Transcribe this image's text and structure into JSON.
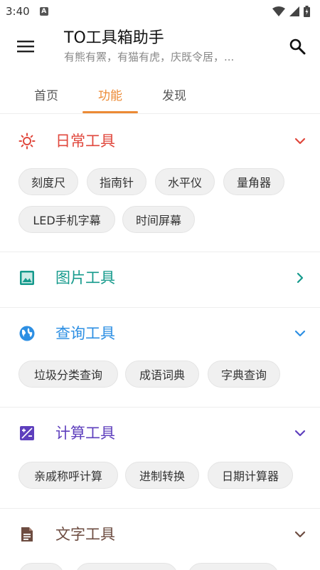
{
  "status_bar": {
    "time": "3:40",
    "badge": "A"
  },
  "app_bar": {
    "title": "TO工具箱助手",
    "subtitle": "有熊有罴，有猫有虎，庆既令居，..."
  },
  "tabs": [
    {
      "label": "首页",
      "active": false
    },
    {
      "label": "功能",
      "active": true
    },
    {
      "label": "发现",
      "active": false
    }
  ],
  "colors": {
    "accent": "#ec8a35",
    "daily": "#e0473c",
    "image": "#159a8c",
    "query": "#2d8fe3",
    "calc": "#5e3fbd",
    "text": "#6d4c41"
  },
  "sections": [
    {
      "title": "日常工具",
      "icon": "sun-icon",
      "expanded": true,
      "chips": [
        "刻度尺",
        "指南针",
        "水平仪",
        "量角器",
        "LED手机字幕",
        "时间屏幕"
      ]
    },
    {
      "title": "图片工具",
      "icon": "image-icon",
      "expanded": false,
      "chips": []
    },
    {
      "title": "查询工具",
      "icon": "globe-icon",
      "expanded": true,
      "chips": [
        "垃圾分类查询",
        "成语词典",
        "字典查询"
      ]
    },
    {
      "title": "计算工具",
      "icon": "calculator-icon",
      "expanded": true,
      "chips": [
        "亲戚称呼计算",
        "进制转换",
        "日期计算器"
      ]
    },
    {
      "title": "文字工具",
      "icon": "document-icon",
      "expanded": true,
      "chips": []
    }
  ]
}
